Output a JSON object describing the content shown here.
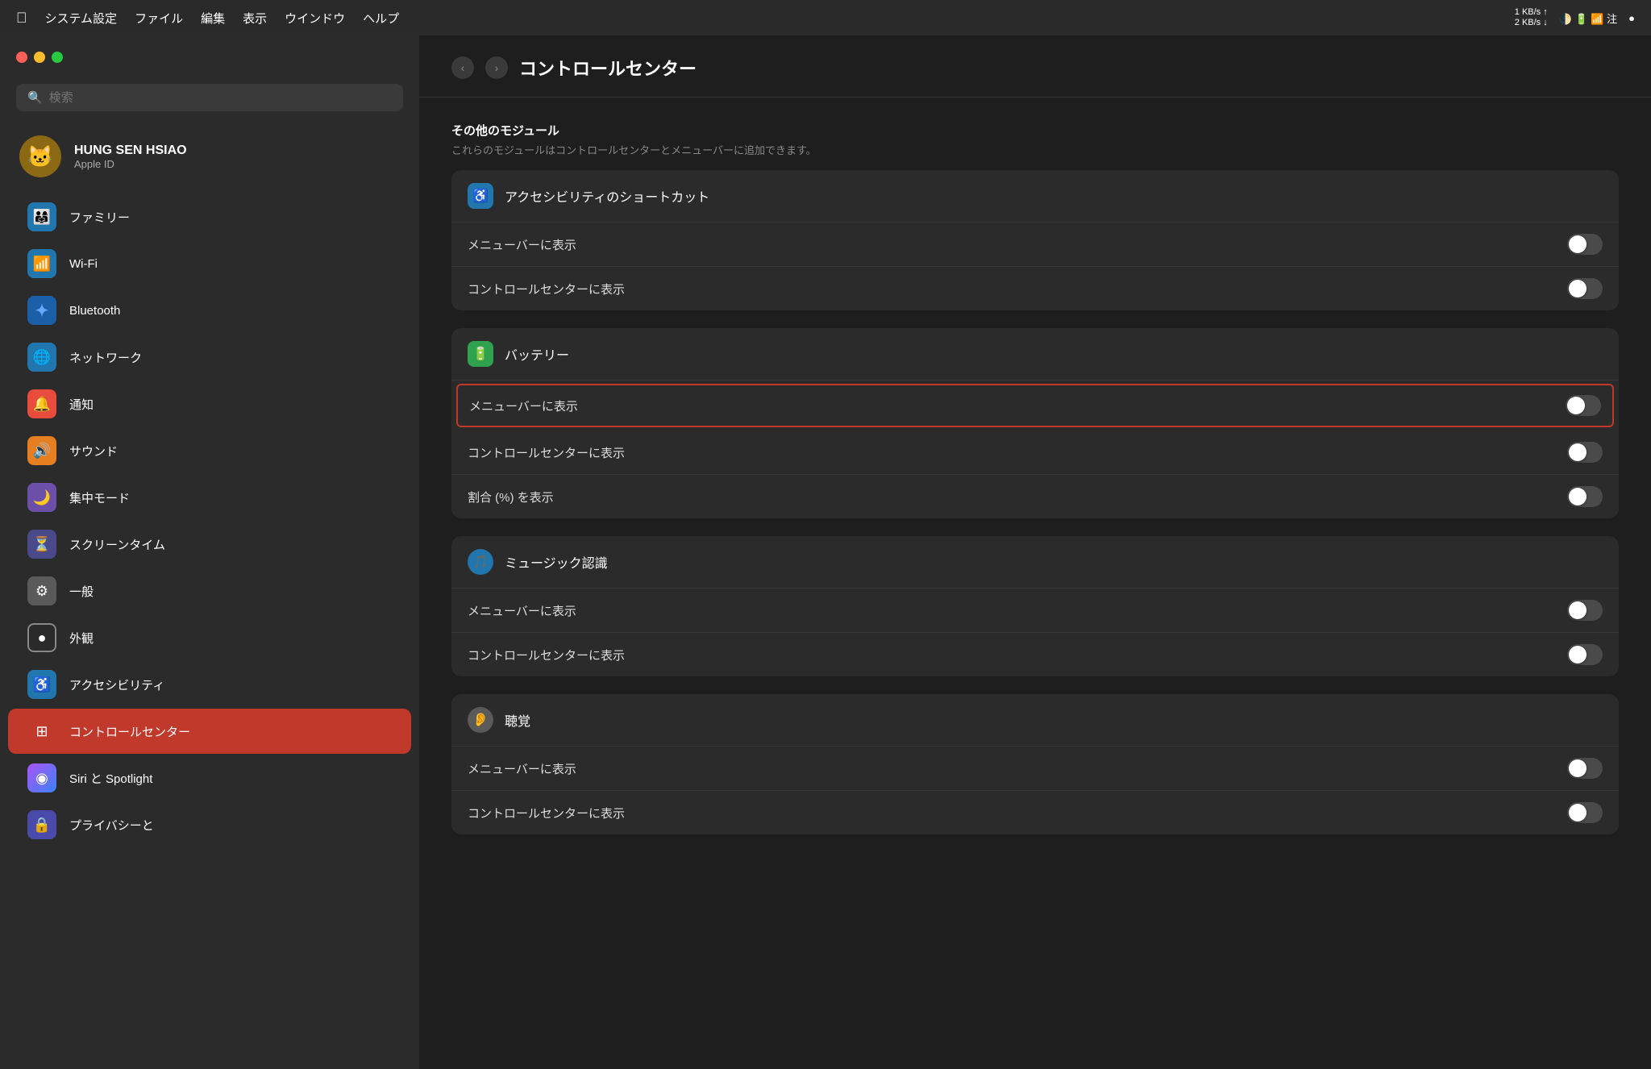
{
  "menubar": {
    "apple": "",
    "items": [
      "システム設定",
      "ファイル",
      "編集",
      "表示",
      "ウインドウ",
      "ヘルプ"
    ],
    "speed": "1 KB/s ↑\n2 KB/s ↓",
    "time": "注"
  },
  "sidebar": {
    "search_placeholder": "検索",
    "user": {
      "name": "HUNG SEN HSIAO",
      "sub": "Apple ID",
      "emoji": "🐱"
    },
    "items": [
      {
        "id": "family",
        "label": "ファミリー",
        "icon": "👨‍👩‍👧",
        "iconClass": "icon-blue"
      },
      {
        "id": "wifi",
        "label": "Wi-Fi",
        "icon": "📶",
        "iconClass": "icon-blue"
      },
      {
        "id": "bluetooth",
        "label": "Bluetooth",
        "icon": "✦",
        "iconClass": "icon-bluetooth"
      },
      {
        "id": "network",
        "label": "ネットワーク",
        "icon": "🌐",
        "iconClass": "icon-globe"
      },
      {
        "id": "notification",
        "label": "通知",
        "icon": "🔔",
        "iconClass": "icon-red"
      },
      {
        "id": "sound",
        "label": "サウンド",
        "icon": "🔊",
        "iconClass": "icon-orange"
      },
      {
        "id": "focus",
        "label": "集中モード",
        "icon": "🌙",
        "iconClass": "icon-purple"
      },
      {
        "id": "screentime",
        "label": "スクリーンタイム",
        "icon": "⏳",
        "iconClass": "icon-indigo"
      },
      {
        "id": "general",
        "label": "一般",
        "icon": "⚙",
        "iconClass": "icon-gray"
      },
      {
        "id": "appearance",
        "label": "外観",
        "icon": "●",
        "iconClass": "icon-white-ring"
      },
      {
        "id": "accessibility",
        "label": "アクセシビリティ",
        "icon": "♿",
        "iconClass": "icon-accessibility"
      },
      {
        "id": "controlcenter",
        "label": "コントロールセンター",
        "icon": "⊞",
        "iconClass": "icon-control",
        "active": true
      },
      {
        "id": "siri",
        "label": "Siri と Spotlight",
        "icon": "◉",
        "iconClass": "icon-siri"
      },
      {
        "id": "privacy",
        "label": "プライバシーと",
        "icon": "🔒",
        "iconClass": "icon-privacy"
      }
    ]
  },
  "content": {
    "title": "コントロールセンター",
    "section_other": {
      "title": "その他のモジュール",
      "subtitle": "これらのモジュールはコントロールセンターとメニューバーに追加できます。"
    },
    "cards": [
      {
        "id": "accessibility-shortcut",
        "title": "アクセシビリティのショートカット",
        "iconBg": "#2176ae",
        "icon": "♿",
        "rows": [
          {
            "label": "メニューバーに表示",
            "toggled": false,
            "highlighted": false
          },
          {
            "label": "コントロールセンターに表示",
            "toggled": false,
            "highlighted": false
          }
        ]
      },
      {
        "id": "battery",
        "title": "バッテリー",
        "iconBg": "#30a14e",
        "icon": "🔋",
        "rows": [
          {
            "label": "メニューバーに表示",
            "toggled": false,
            "highlighted": true
          },
          {
            "label": "コントロールセンターに表示",
            "toggled": false,
            "highlighted": false
          },
          {
            "label": "割合 (%) を表示",
            "toggled": false,
            "highlighted": false
          }
        ]
      },
      {
        "id": "music-recognition",
        "title": "ミュージック認識",
        "iconBg": "#2176ae",
        "icon": "🎵",
        "rows": [
          {
            "label": "メニューバーに表示",
            "toggled": false,
            "highlighted": false
          },
          {
            "label": "コントロールセンターに表示",
            "toggled": false,
            "highlighted": false
          }
        ]
      },
      {
        "id": "hearing",
        "title": "聴覚",
        "iconBg": "#5a5a5a",
        "icon": "👂",
        "rows": [
          {
            "label": "メニューバーに表示",
            "toggled": false,
            "highlighted": false
          },
          {
            "label": "コントロールセンターに表示",
            "toggled": false,
            "highlighted": false
          }
        ]
      }
    ]
  }
}
